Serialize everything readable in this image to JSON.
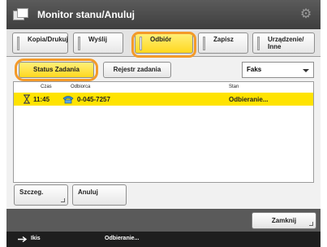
{
  "window": {
    "title": "Monitor stanu/Anuluj"
  },
  "tabs": [
    {
      "label": "Kopia/Drukuj",
      "active": false
    },
    {
      "label": "Wyślij",
      "active": false
    },
    {
      "label": "Odbiór",
      "active": true
    },
    {
      "label": "Zapisz",
      "active": false
    },
    {
      "label": "Urządzenie/ Inne",
      "active": false
    }
  ],
  "subtabs": {
    "status_label": "Status Zadania",
    "log_label": "Rejestr zadania"
  },
  "filter": {
    "selected": "Faks"
  },
  "list": {
    "headers": {
      "time": "Czas",
      "sender": "Odbiorca",
      "status": "Stan"
    },
    "rows": [
      {
        "time": "11:45",
        "sender": "0-045-7257",
        "status": "Odbieranie..."
      }
    ]
  },
  "buttons": {
    "details": "Szczeg.",
    "cancel": "Anuluj",
    "close": "Zamknij"
  },
  "status_bar": {
    "left": "Ikis",
    "message": "Odbieranie..."
  },
  "colors": {
    "accent_yellow": "#ffe300",
    "highlight_orange": "#f39a2a",
    "titlebar": "#4a4a4a"
  }
}
